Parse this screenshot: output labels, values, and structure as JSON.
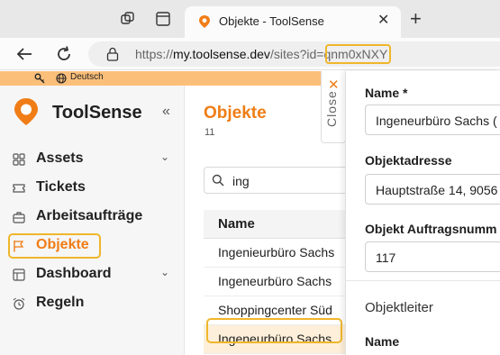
{
  "browser": {
    "tab_title": "Objekte - ToolSense",
    "url_prefix": "https://",
    "url_domain": "my.toolsense.dev",
    "url_path": "/sites?id=qnm0xNXY"
  },
  "banner": {
    "language": "Deutsch"
  },
  "sidebar": {
    "brand": "ToolSense",
    "items": [
      {
        "label": "Assets",
        "icon": "grid-icon",
        "has_submenu": true
      },
      {
        "label": "Tickets",
        "icon": "ticket-icon",
        "has_submenu": false
      },
      {
        "label": "Arbeitsaufträge",
        "icon": "briefcase-icon",
        "has_submenu": false
      },
      {
        "label": "Objekte",
        "icon": "flag-icon",
        "has_submenu": false,
        "active": true
      },
      {
        "label": "Dashboard",
        "icon": "dashboard-icon",
        "has_submenu": true
      },
      {
        "label": "Regeln",
        "icon": "alarm-icon",
        "has_submenu": false
      }
    ]
  },
  "main": {
    "title": "Objekte",
    "count": "11",
    "close_label": "Close",
    "search_value": "ing",
    "table": {
      "header": "Name",
      "rows": [
        "Ingenieurbüro Sachs",
        "Ingeneurbüro Sachs",
        "Shoppingcenter Süd",
        "Ingeneurbüro Sachs"
      ],
      "selected_index": 3
    }
  },
  "detail": {
    "name_label": "Name *",
    "name_value": "Ingeneurbüro Sachs (",
    "address_label": "Objektadresse",
    "address_value": "Hauptstraße 14, 9056",
    "order_label": "Objekt Auftragsnumm",
    "order_value": "117",
    "manager_section": "Objektleiter",
    "manager_name_label": "Name"
  },
  "colors": {
    "accent": "#f07d16",
    "highlight": "#f0b62b",
    "banner": "#fbbf7a"
  }
}
